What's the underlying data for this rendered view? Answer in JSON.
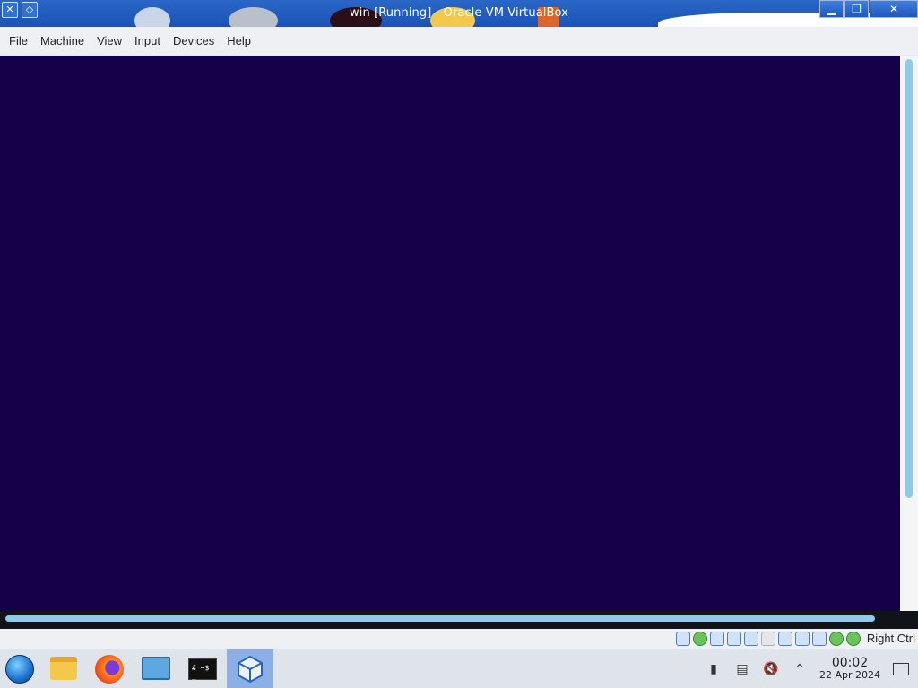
{
  "window": {
    "title": "win [Running] - Oracle VM VirtualBox",
    "controls": [
      "minimize",
      "restore",
      "close"
    ]
  },
  "menu": {
    "items": [
      "File",
      "Machine",
      "View",
      "Input",
      "Devices",
      "Help"
    ]
  },
  "vm_display": {
    "background_color": "#15014a"
  },
  "statusbar": {
    "host_key_label": "Right Ctrl",
    "icons": [
      "hard-disk-icon",
      "optical-drive-icon",
      "audio-icon",
      "network-icon",
      "usb-icon",
      "shared-folders-icon",
      "display-icon",
      "video-capture-icon",
      "mouse-integration-icon",
      "cpu-icon",
      "keyboard-icon"
    ]
  },
  "taskbar": {
    "apps": [
      "start-menu",
      "file-manager",
      "firefox",
      "system-settings",
      "terminal",
      "virtualbox"
    ],
    "active_app": "virtualbox",
    "terminal_label": "# ~$ _",
    "clock": {
      "time": "00:02",
      "date": "22 Apr 2024"
    }
  },
  "colors": {
    "titlebar": "#1f5bc0",
    "scroll_thumb": "#8ecbe9",
    "vm_bg": "#15014a"
  }
}
